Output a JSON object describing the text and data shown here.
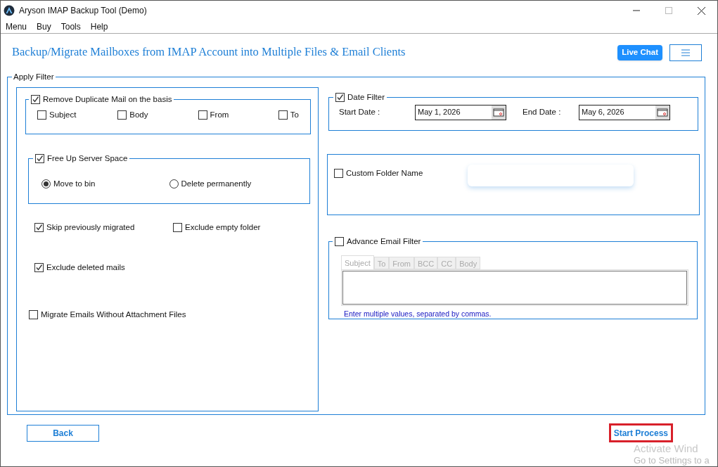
{
  "window": {
    "title": "Aryson IMAP Backup Tool (Demo)"
  },
  "menu": [
    "Menu",
    "Buy",
    "Tools",
    "Help"
  ],
  "header": {
    "title": "Backup/Migrate Mailboxes from IMAP Account into Multiple Files & Email Clients",
    "live_chat": "Live Chat"
  },
  "apply_filter": {
    "legend": "Apply Filter",
    "duplicate": {
      "label": "Remove Duplicate Mail on the basis",
      "checked": true,
      "options": [
        {
          "label": "Subject",
          "checked": false
        },
        {
          "label": "Body",
          "checked": false
        },
        {
          "label": "From",
          "checked": false
        },
        {
          "label": "To",
          "checked": false
        }
      ]
    },
    "free_space": {
      "label": "Free Up Server Space",
      "checked": true,
      "options": [
        {
          "label": "Move to bin",
          "selected": true
        },
        {
          "label": "Delete permanently",
          "selected": false
        }
      ]
    },
    "rows": [
      [
        {
          "label": "Skip previously migrated",
          "checked": true
        },
        {
          "label": "Exclude empty folder",
          "checked": false
        }
      ],
      [
        {
          "label": "Exclude deleted mails",
          "checked": true
        }
      ],
      [
        {
          "label": "Migrate Emails Without Attachment Files",
          "checked": false
        }
      ]
    ],
    "date_filter": {
      "label": "Date Filter",
      "checked": true,
      "start_label": "Start Date :",
      "start": "May 1, 2026",
      "end_label": "End Date :",
      "end": "May 6, 2026"
    },
    "custom_folder": {
      "label": "Custom Folder Name",
      "checked": false
    },
    "advance_filter": {
      "label": "Advance Email Filter",
      "checked": false,
      "tabs": [
        {
          "label": "Subject",
          "selected": true
        },
        {
          "label": "To",
          "selected": false
        },
        {
          "label": "From",
          "selected": false
        },
        {
          "label": "BCC",
          "selected": false
        },
        {
          "label": "CC",
          "selected": false
        },
        {
          "label": "Body",
          "selected": false
        }
      ],
      "hint": "Enter multiple values, separated by commas."
    }
  },
  "buttons": {
    "back": "Back",
    "start": "Start Process",
    "start_highlighted": true
  },
  "activation": {
    "line1": "Activate Wind",
    "line2": "Go to Settings to a"
  }
}
